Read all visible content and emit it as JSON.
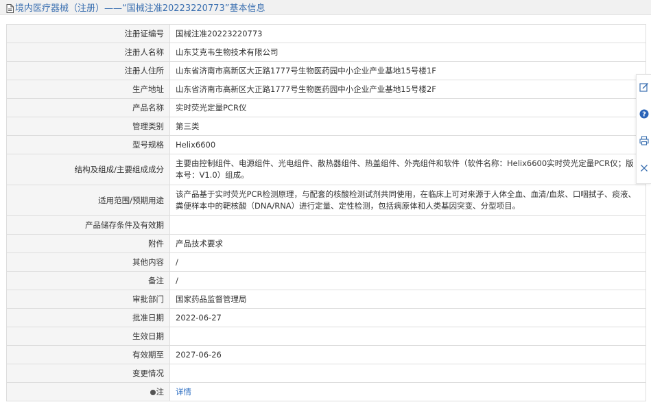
{
  "header": {
    "title": "境内医疗器械（注册）——“国械注准20223220773”基本信息"
  },
  "rows": [
    {
      "label": "注册证编号",
      "value": "国械注准20223220773"
    },
    {
      "label": "注册人名称",
      "value": "山东艾克韦生物技术有限公司"
    },
    {
      "label": "注册人住所",
      "value": "山东省济南市高新区大正路1777号生物医药园中小企业产业基地15号楼1F"
    },
    {
      "label": "生产地址",
      "value": "山东省济南市高新区大正路1777号生物医药园中小企业产业基地15号楼2F"
    },
    {
      "label": "产品名称",
      "value": "实时荧光定量PCR仪"
    },
    {
      "label": "管理类别",
      "value": "第三类"
    },
    {
      "label": "型号规格",
      "value": "Helix6600"
    },
    {
      "label": "结构及组成/主要组成成分",
      "value": "主要由控制组件、电源组件、光电组件、散热器组件、热盖组件、外壳组件和软件（软件名称：Helix6600实时荧光定量PCR仪；版本号：V1.0）组成。"
    },
    {
      "label": "适用范围/预期用途",
      "value": "该产品基于实时荧光PCR检测原理，与配套的核酸检测试剂共同使用，在临床上可对来源于人体全血、血清/血浆、口咽拭子、痰液、粪便样本中的靶核酸（DNA/RNA）进行定量、定性检测，包括病原体和人类基因突变、分型项目。"
    },
    {
      "label": "产品储存条件及有效期",
      "value": ""
    },
    {
      "label": "附件",
      "value": "产品技术要求"
    },
    {
      "label": "其他内容",
      "value": "/"
    },
    {
      "label": "备注",
      "value": "/"
    },
    {
      "label": "审批部门",
      "value": "国家药品监督管理局"
    },
    {
      "label": "批准日期",
      "value": "2022-06-27"
    },
    {
      "label": "生效日期",
      "value": ""
    },
    {
      "label": "有效期至",
      "value": "2027-06-26"
    },
    {
      "label": "变更情况",
      "value": ""
    }
  ],
  "note_row": {
    "label": "注",
    "link_text": "详情"
  },
  "sidebar_icons": [
    "edit-icon",
    "help-icon",
    "print-icon",
    "close-icon"
  ],
  "colors": {
    "title": "#3a6fb0",
    "link": "#2d6ec2",
    "label_bg": "#f5f5f5",
    "border": "#dddddd"
  }
}
